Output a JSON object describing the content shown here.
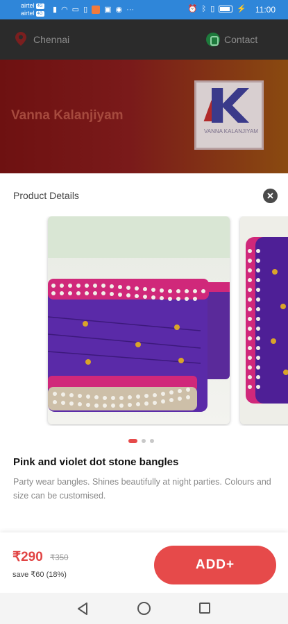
{
  "status_bar": {
    "carrier_1": "airtel",
    "carrier_2": "airtel",
    "network_tag": "4G",
    "battery": "",
    "time": "11:00"
  },
  "background": {
    "location": "Chennai",
    "contact_label": "Contact",
    "store_name": "Vanna Kalanjiyam",
    "logo_text": "VANNA KALANJIYAM"
  },
  "sheet": {
    "title": "Product Details",
    "close_symbol": "✕"
  },
  "carousel": {
    "slides": [
      {
        "alt": "Pink and violet dot stone bangles, image 1"
      },
      {
        "alt": "Pink and violet dot stone bangles, image 2"
      }
    ],
    "total": 3,
    "active_index": 0
  },
  "product": {
    "name": "Pink and violet dot stone bangles",
    "description": "Party wear bangles. Shines beautifully at night parties. Colours and size can be customised."
  },
  "pricing": {
    "price": "₹290",
    "mrp": "₹350",
    "savings": "save ₹60 (18%)"
  },
  "actions": {
    "add_label": "ADD+"
  },
  "colors": {
    "accent": "#e64a4a",
    "status_bar": "#2f86d9"
  }
}
